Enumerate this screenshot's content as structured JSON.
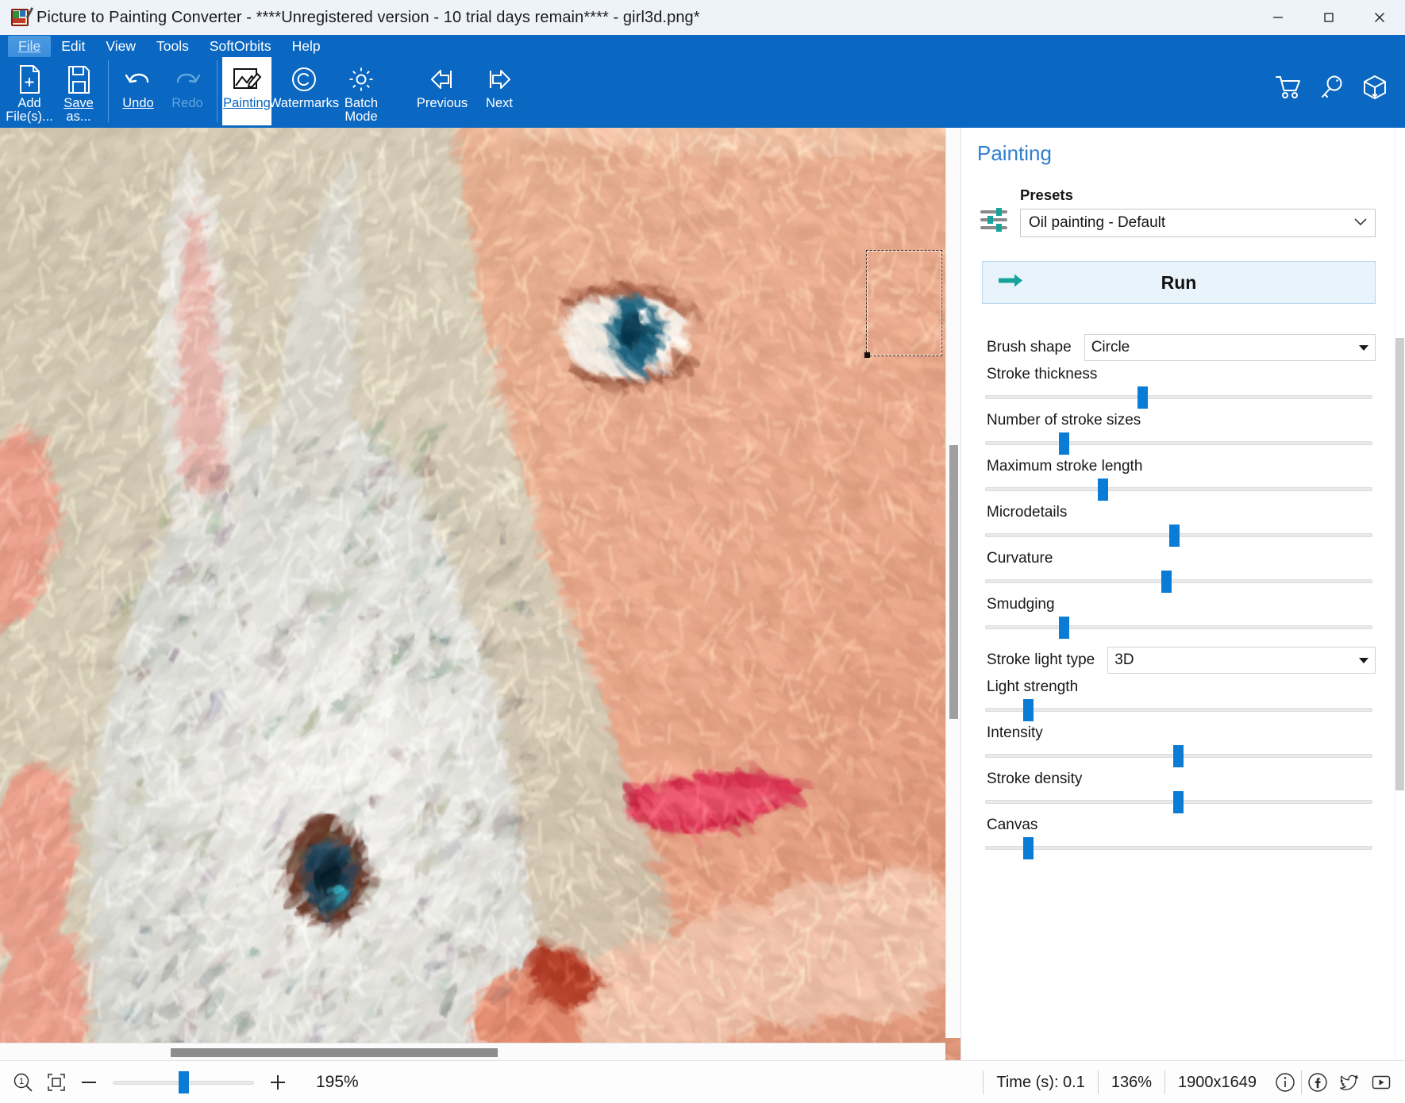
{
  "window": {
    "title": "Picture to Painting Converter - ****Unregistered version - 10 trial days remain**** - girl3d.png*",
    "icon": "app-icon",
    "minimize": "minimize-icon",
    "maximize": "maximize-icon",
    "close": "close-icon"
  },
  "menubar": [
    {
      "label": "File",
      "mnemonic": "F",
      "active": true
    },
    {
      "label": "Edit",
      "mnemonic": "E",
      "active": false
    },
    {
      "label": "View",
      "mnemonic": "V",
      "active": false
    },
    {
      "label": "Tools",
      "mnemonic": "T",
      "active": false
    },
    {
      "label": "SoftOrbits",
      "mnemonic": "",
      "active": false
    },
    {
      "label": "Help",
      "mnemonic": "H",
      "active": false
    }
  ],
  "toolbar": {
    "add_files": {
      "line1": "Add",
      "line2": "File(s)...",
      "icon": "add-file-icon"
    },
    "save_as": {
      "line1": "Save",
      "line2": "as...",
      "icon": "save-icon"
    },
    "undo": {
      "label": "Undo",
      "icon": "undo-arrow-icon",
      "enabled": true
    },
    "redo": {
      "label": "Redo",
      "icon": "redo-arrow-icon",
      "enabled": false
    },
    "painting": {
      "label": "Painting",
      "icon": "painting-icon",
      "selected": true
    },
    "watermarks": {
      "label": "Watermarks",
      "icon": "copyright-icon"
    },
    "batch_mode": {
      "line1": "Batch",
      "line2": "Mode",
      "icon": "gear-icon"
    },
    "previous": {
      "label": "Previous",
      "icon": "previous-arrow-icon"
    },
    "next": {
      "label": "Next",
      "icon": "next-arrow-icon"
    },
    "right_icons": [
      {
        "name": "cart-icon"
      },
      {
        "name": "key-icon"
      },
      {
        "name": "box-icon"
      }
    ]
  },
  "panel": {
    "title": "Painting",
    "presets": {
      "icon": "sliders-icon",
      "label": "Presets",
      "value": "Oil painting - Default",
      "chevron": "chevron-down-icon"
    },
    "run": {
      "label": "Run",
      "icon": "run-arrow-icon"
    },
    "brush_shape": {
      "label": "Brush shape",
      "value": "Circle"
    },
    "stroke_light_type": {
      "label": "Stroke light type",
      "value": "3D"
    },
    "sliders": [
      {
        "label": "Stroke thickness",
        "percent": 41
      },
      {
        "label": "Number of stroke sizes",
        "percent": 21
      },
      {
        "label": "Maximum stroke length",
        "percent": 31
      },
      {
        "label": "Microdetails",
        "percent": 49
      },
      {
        "label": "Curvature",
        "percent": 47
      },
      {
        "label": "Smudging",
        "percent": 21
      },
      {
        "label": "Light strength",
        "percent": 12
      },
      {
        "label": "Intensity",
        "percent": 50
      },
      {
        "label": "Stroke density",
        "percent": 50
      },
      {
        "label": "Canvas",
        "percent": 12
      }
    ]
  },
  "statusbar": {
    "fit_icon": "zoom-actual-size-icon",
    "fit_screen_icon": "fit-to-screen-icon",
    "zoom_out": "minus-icon",
    "zoom_in": "plus-icon",
    "zoom_percent": "195%",
    "zoom_slider_percent": 50,
    "time": "Time (s): 0.1",
    "scale": "136%",
    "scale_suffix": "%",
    "dimensions": "1900x1649",
    "info_icon": "info-icon",
    "facebook_icon": "facebook-icon",
    "twitter_icon": "twitter-icon",
    "youtube_icon": "youtube-icon"
  },
  "colors": {
    "ribbon": "#0a67c2",
    "accent": "#0a7cd6",
    "panel_title": "#2e7fd1",
    "run_bg": "#e8f3fb"
  }
}
